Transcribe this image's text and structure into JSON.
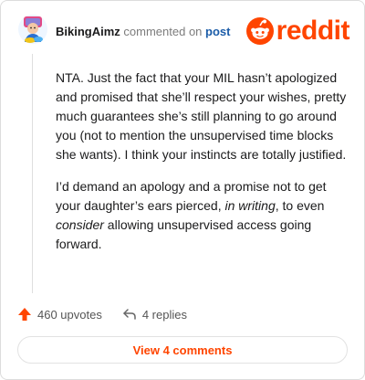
{
  "header": {
    "username": "BikingAimz",
    "commented_text": "commented on",
    "post_link": "post",
    "logo_text": "reddit"
  },
  "comment": {
    "p1": "NTA. Just the fact that your MIL hasn’t apologized and promised that she’ll respect your wishes, pretty much guarantees she’s still planning to go around you (not to mention the unsupervised time blocks she wants). I think your instincts are totally justified.",
    "p2_part1": "I’d demand an apology and a promise not to get your daughter’s ears pierced, ",
    "p2_italic1": "in writing",
    "p2_part2": ", to even ",
    "p2_italic2": "consider",
    "p2_part3": " allowing unsupervised access going forward."
  },
  "footer": {
    "upvotes_label": "460 upvotes",
    "replies_label": "4 replies",
    "view_comments_label": "View 4 comments"
  },
  "icons": {
    "upvote": "upvote-arrow-icon",
    "reply": "reply-arrow-icon",
    "logo": "reddit-snoo-icon",
    "avatar": "user-avatar-icon"
  },
  "colors": {
    "brand": "#ff4500",
    "link": "#1b5ca8",
    "text": "#1a1a1b",
    "muted": "#7c7c7c"
  }
}
